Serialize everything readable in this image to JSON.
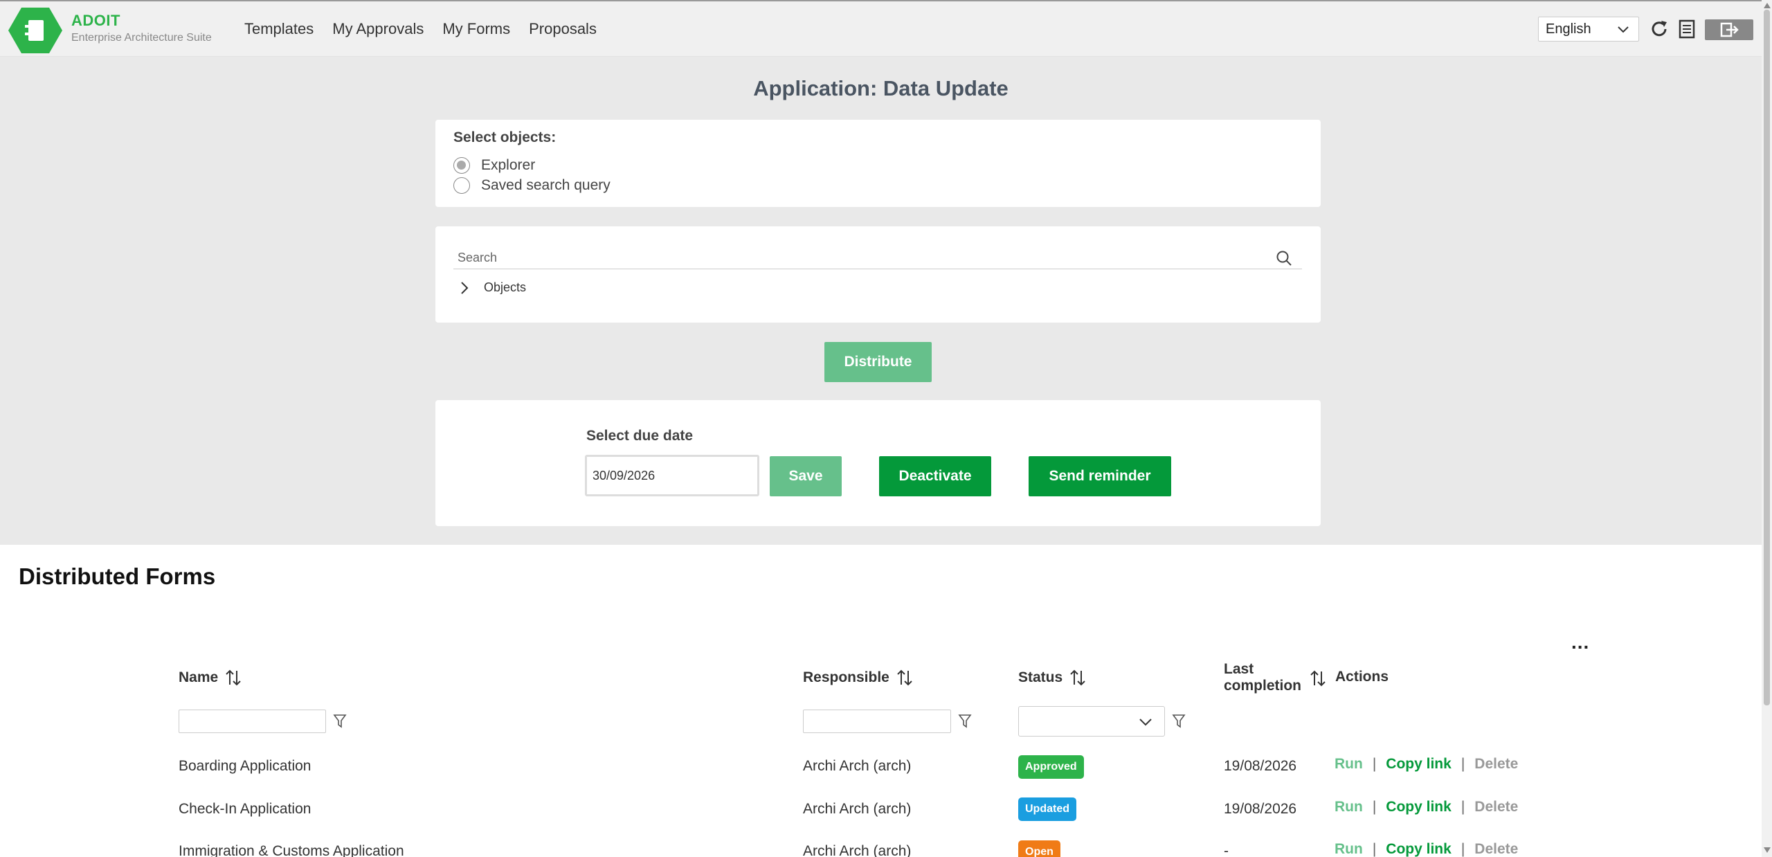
{
  "header": {
    "logo_title": "ADOIT",
    "logo_subtitle": "Enterprise Architecture Suite",
    "nav": [
      "Templates",
      "My Approvals",
      "My Forms",
      "Proposals"
    ],
    "language": "English",
    "icons": [
      "refresh-icon",
      "document-icon",
      "logout-icon"
    ],
    "brand_color": "#2db34a"
  },
  "app": {
    "title": "Application: Data Update",
    "select_objects_label": "Select objects:",
    "radio_options": [
      {
        "label": "Explorer",
        "checked": true
      },
      {
        "label": "Saved search query",
        "checked": false
      }
    ],
    "search_placeholder": "Search",
    "tree_root": "Objects",
    "distribute_label": "Distribute"
  },
  "due": {
    "label": "Select due date",
    "value": "30/09/2026",
    "save_label": "Save",
    "deactivate_label": "Deactivate",
    "reminder_label": "Send reminder"
  },
  "forms": {
    "title": "Distributed Forms",
    "more_label": "...",
    "columns": {
      "name": "Name",
      "responsible": "Responsible",
      "status": "Status",
      "last_completion_1": "Last",
      "last_completion_2": "completion",
      "actions": "Actions"
    },
    "rows": [
      {
        "name": "Boarding Application",
        "responsible": "Archi Arch (arch)",
        "status": "Approved",
        "status_color": "#2db34a",
        "last": "19/08/2026"
      },
      {
        "name": "Check-In Application",
        "responsible": "Archi Arch (arch)",
        "status": "Updated",
        "status_color": "#1a9ee0",
        "last": "19/08/2026"
      },
      {
        "name": "Immigration & Customs Application",
        "responsible": "Archi Arch (arch)",
        "status": "Open",
        "status_color": "#f07b16",
        "last": "-"
      }
    ],
    "actions": {
      "run": "Run",
      "copy": "Copy link",
      "delete": "Delete",
      "sep": "|"
    }
  }
}
